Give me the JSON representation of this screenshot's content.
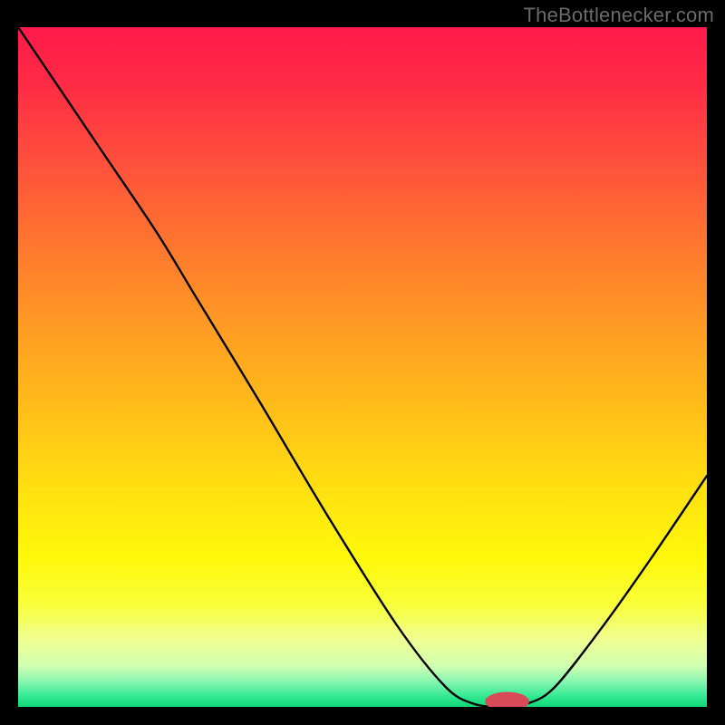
{
  "watermark": "TheBottlenecker.com",
  "chart_data": {
    "type": "line",
    "title": "",
    "xlabel": "",
    "ylabel": "",
    "xlim": [
      0,
      100
    ],
    "ylim": [
      0,
      100
    ],
    "background_gradient": {
      "stops": [
        {
          "offset": 0.0,
          "color": "#ff1a4b"
        },
        {
          "offset": 0.08,
          "color": "#ff2a45"
        },
        {
          "offset": 0.18,
          "color": "#ff4a3e"
        },
        {
          "offset": 0.3,
          "color": "#ff7030"
        },
        {
          "offset": 0.42,
          "color": "#ff9525"
        },
        {
          "offset": 0.55,
          "color": "#ffba1a"
        },
        {
          "offset": 0.68,
          "color": "#ffe010"
        },
        {
          "offset": 0.78,
          "color": "#fff80a"
        },
        {
          "offset": 0.85,
          "color": "#f8ff3a"
        },
        {
          "offset": 0.9,
          "color": "#f0ff90"
        },
        {
          "offset": 0.94,
          "color": "#d0ffb0"
        },
        {
          "offset": 0.965,
          "color": "#80f5b0"
        },
        {
          "offset": 0.985,
          "color": "#30e890"
        },
        {
          "offset": 1.0,
          "color": "#10d878"
        }
      ]
    },
    "series": [
      {
        "name": "bottleneck-curve",
        "color": "#000000",
        "points": [
          {
            "x": 0,
            "y": 100
          },
          {
            "x": 12,
            "y": 82
          },
          {
            "x": 20,
            "y": 70
          },
          {
            "x": 26,
            "y": 60
          },
          {
            "x": 35,
            "y": 45
          },
          {
            "x": 45,
            "y": 28
          },
          {
            "x": 55,
            "y": 12
          },
          {
            "x": 62,
            "y": 3
          },
          {
            "x": 66,
            "y": 0.5
          },
          {
            "x": 70,
            "y": 0
          },
          {
            "x": 74,
            "y": 0.5
          },
          {
            "x": 78,
            "y": 3
          },
          {
            "x": 85,
            "y": 12
          },
          {
            "x": 92,
            "y": 22
          },
          {
            "x": 100,
            "y": 34
          }
        ]
      }
    ],
    "marker": {
      "name": "optimal-point",
      "x": 71,
      "y": 0,
      "rx": 3.2,
      "ry": 1.4,
      "color": "#d84a5a"
    }
  }
}
